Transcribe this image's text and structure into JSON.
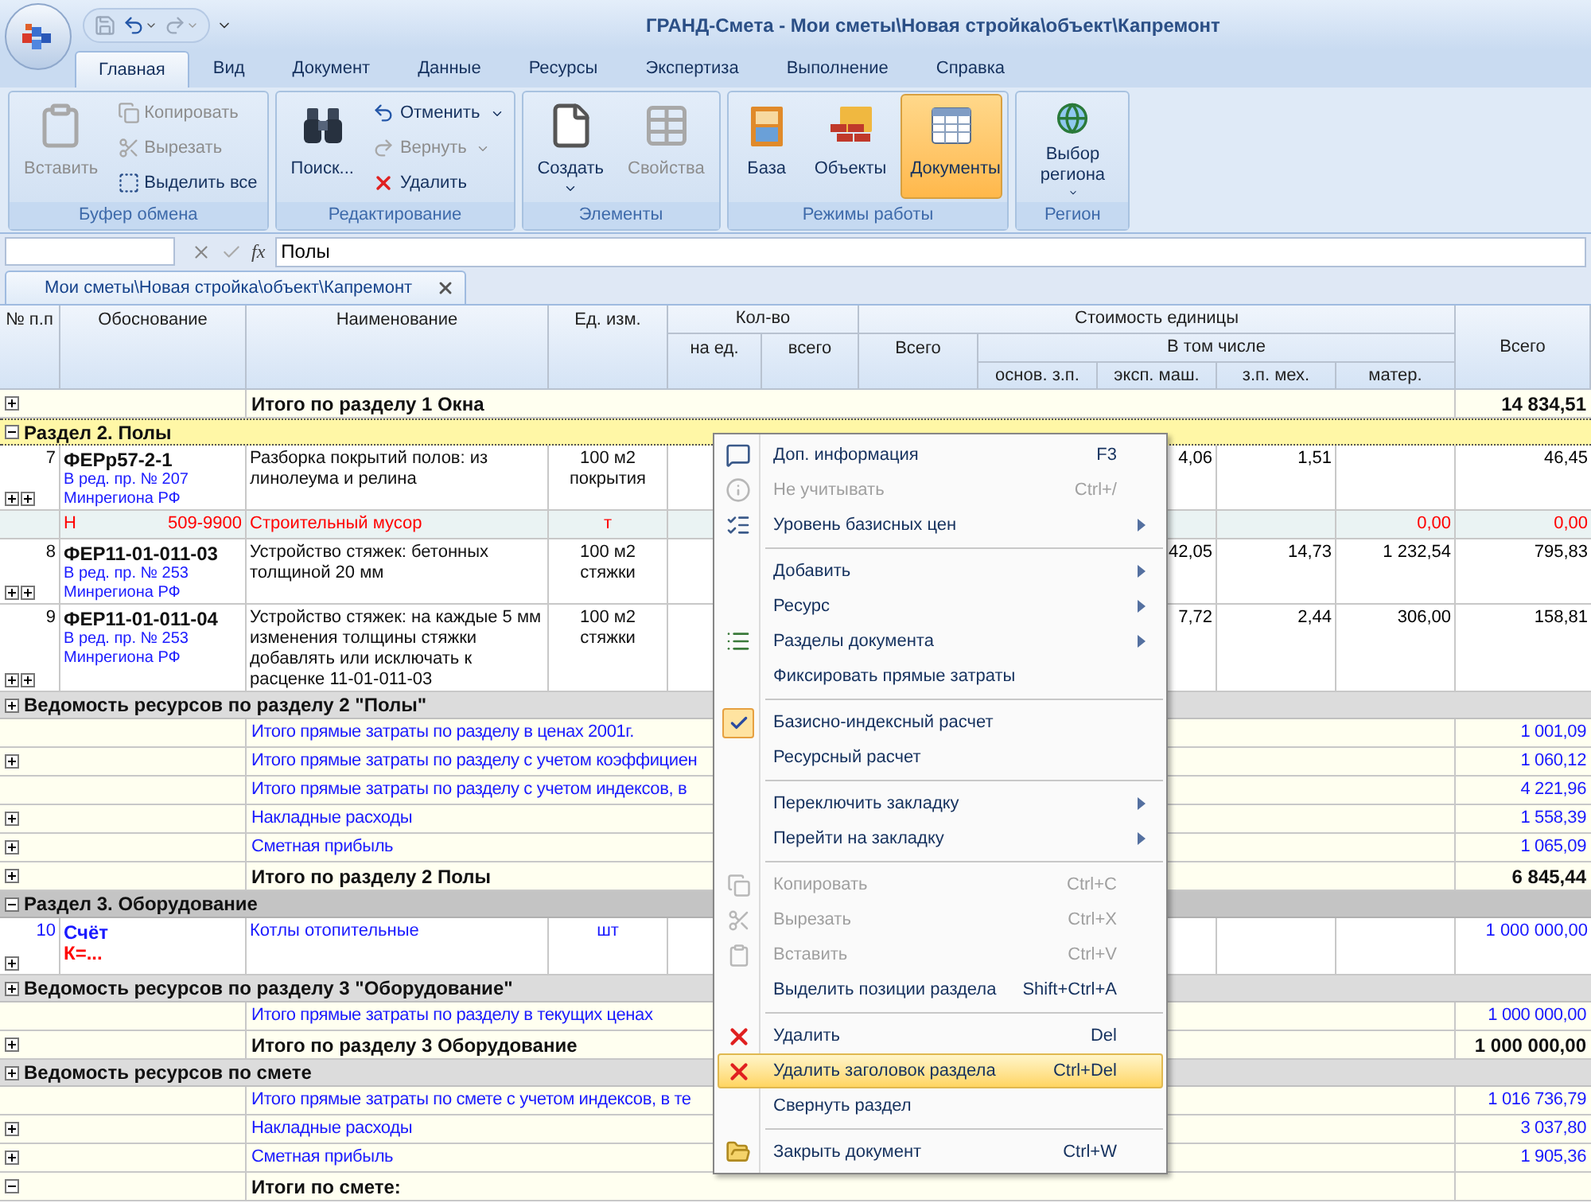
{
  "window": {
    "title": "ГРАНД-Смета - Мои сметы\\Новая стройка\\объект\\Капремонт"
  },
  "ribbon_tabs": [
    {
      "label": "Главная",
      "selected": true
    },
    {
      "label": "Вид",
      "selected": false
    },
    {
      "label": "Документ",
      "selected": false
    },
    {
      "label": "Данные",
      "selected": false
    },
    {
      "label": "Ресурсы",
      "selected": false
    },
    {
      "label": "Экспертиза",
      "selected": false
    },
    {
      "label": "Выполнение",
      "selected": false
    },
    {
      "label": "Справка",
      "selected": false
    }
  ],
  "ribbon_groups": [
    {
      "title": "Буфер обмена",
      "buttons": [
        {
          "label": "Вставить",
          "kind": "large",
          "disabled": true,
          "selected": false,
          "dropdown": false
        },
        {
          "label": "Копировать",
          "kind": "small",
          "disabled": true,
          "selected": false,
          "dropdown": false
        },
        {
          "label": "Вырезать",
          "kind": "small",
          "disabled": true,
          "selected": false,
          "dropdown": false
        },
        {
          "label": "Выделить все",
          "kind": "small",
          "disabled": false,
          "selected": false,
          "dropdown": false
        }
      ]
    },
    {
      "title": "Редактирование",
      "buttons": [
        {
          "label": "Поиск...",
          "kind": "large",
          "disabled": false,
          "selected": false,
          "dropdown": false
        },
        {
          "label": "Отменить",
          "kind": "small",
          "disabled": false,
          "selected": false,
          "dropdown": true
        },
        {
          "label": "Вернуть",
          "kind": "small",
          "disabled": true,
          "selected": false,
          "dropdown": true
        },
        {
          "label": "Удалить",
          "kind": "small",
          "disabled": false,
          "selected": false,
          "dropdown": false
        }
      ]
    },
    {
      "title": "Элементы",
      "buttons": [
        {
          "label": "Создать",
          "kind": "large",
          "disabled": false,
          "selected": false,
          "dropdown": true
        },
        {
          "label": "Свойства",
          "kind": "large",
          "disabled": true,
          "selected": false,
          "dropdown": false
        }
      ]
    },
    {
      "title": "Режимы работы",
      "buttons": [
        {
          "label": "База",
          "kind": "large",
          "disabled": false,
          "selected": false,
          "dropdown": false
        },
        {
          "label": "Объекты",
          "kind": "large",
          "disabled": false,
          "selected": false,
          "dropdown": false
        },
        {
          "label": "Документы",
          "kind": "large",
          "disabled": false,
          "selected": true,
          "dropdown": false
        }
      ]
    },
    {
      "title": "Регион",
      "buttons": [
        {
          "label": "Выбор региона",
          "kind": "large",
          "disabled": false,
          "selected": false,
          "dropdown": true
        }
      ]
    }
  ],
  "formula_bar": {
    "function_label": "fx",
    "value": "Полы"
  },
  "document_tab": {
    "label": "Мои сметы\\Новая стройка\\объект\\Капремонт"
  },
  "table": {
    "headers": {
      "number": "№ п.п",
      "basis": "Обоснование",
      "name": "Наименование",
      "unit": "Ед. изм.",
      "quantity": "Кол-во",
      "per_unit": "на ед.",
      "quantity_total": "всего",
      "unit_cost": "Стоимость единицы",
      "unit_cost_total": "Всего",
      "including": "В том числе",
      "base_wage": "основ. з.п.",
      "machines": "эксп. маш.",
      "mech_wage": "з.п. мех.",
      "materials": "матер.",
      "total": "Всего"
    },
    "rows": [
      {
        "kind": "total",
        "expanded": false,
        "name": "Итого по разделу 1 Окна",
        "total": "14 834,51",
        "selected": false
      },
      {
        "kind": "section",
        "expanded": true,
        "label": "Раздел 2. Полы",
        "selected": true
      },
      {
        "kind": "position",
        "number": "7",
        "code": "ФЕРр57-2-1",
        "note": "В ред. пр. № 207 Минрегиона РФ",
        "name": "Разборка покрытий полов: из линолеума и релина",
        "unit": "100 м2\nпокрытия",
        "expanders": [
          false,
          false
        ],
        "machines": "4,06",
        "mech_wage": "1,51",
        "total": "46,45",
        "selected": false
      },
      {
        "kind": "resource",
        "prefix": "Н",
        "code": "509-9900",
        "name": "Строительный мусор",
        "unit": "т",
        "materials": "0,00",
        "total": "0,00",
        "selected": false
      },
      {
        "kind": "position",
        "number": "8",
        "code": "ФЕР11-01-011-03",
        "note": "В ред. пр. № 253 Минрегиона РФ",
        "name": "Устройство стяжек: бетонных толщиной 20 мм",
        "unit": "100 м2\nстяжки",
        "expanders": [
          false,
          false
        ],
        "machines": "42,05",
        "mech_wage": "14,73",
        "materials": "1 232,54",
        "total": "795,83",
        "selected": false
      },
      {
        "kind": "position",
        "number": "9",
        "code": "ФЕР11-01-011-04",
        "note": "В ред. пр. № 253 Минрегиона РФ",
        "name": "Устройство стяжек: на каждые 5 мм изменения толщины стяжки добавлять или исключать к расценке 11-01-011-03",
        "unit": "100 м2\nстяжки",
        "expanders": [
          false,
          false
        ],
        "machines": "7,72",
        "mech_wage": "2,44",
        "materials": "306,00",
        "total": "158,81",
        "selected": false
      },
      {
        "kind": "statement",
        "expanded": false,
        "label": "Ведомость ресурсов по разделу 2 \"Полы\"",
        "selected": false
      },
      {
        "kind": "subtotal",
        "name": "Итого прямые затраты по разделу в ценах 2001г.",
        "total": "1 001,09",
        "selected": false
      },
      {
        "kind": "subtotal",
        "expanded": false,
        "name": "Итого прямые затраты по разделу с учетом коэффициен",
        "total": "1 060,12",
        "selected": false
      },
      {
        "kind": "subtotal",
        "name": "Итого прямые затраты по разделу с учетом индексов, в",
        "total": "4 221,96",
        "selected": false
      },
      {
        "kind": "subtotal",
        "expanded": false,
        "name": "Накладные расходы",
        "total": "1 558,39",
        "selected": false
      },
      {
        "kind": "subtotal",
        "expanded": false,
        "name": "Сметная прибыль",
        "total": "1 065,09",
        "selected": false
      },
      {
        "kind": "total",
        "expanded": false,
        "name": "Итого по разделу 2 Полы",
        "total": "6 845,44",
        "selected": false
      },
      {
        "kind": "section",
        "expanded": true,
        "label": "Раздел 3. Оборудование",
        "selected": false
      },
      {
        "kind": "invoice",
        "number": "10",
        "code": "Счёт",
        "note": "К=...",
        "name": "Котлы отопительные",
        "unit": "шт",
        "expanders": [
          false
        ],
        "total": "1 000 000,00",
        "selected": false
      },
      {
        "kind": "statement",
        "expanded": false,
        "label": "Ведомость ресурсов по разделу 3 \"Оборудование\"",
        "selected": false
      },
      {
        "kind": "subtotal",
        "name": "Итого прямые затраты по разделу в текущих ценах",
        "total": "1 000 000,00",
        "selected": false
      },
      {
        "kind": "total",
        "expanded": false,
        "name": "Итого по разделу 3 Оборудование",
        "total": "1 000 000,00",
        "selected": false
      },
      {
        "kind": "statement",
        "expanded": false,
        "label": "Ведомость ресурсов по смете",
        "selected": false
      },
      {
        "kind": "subtotal",
        "name": "Итого прямые затраты по смете с учетом индексов, в те",
        "total": "1 016 736,79",
        "selected": false
      },
      {
        "kind": "subtotal",
        "expanded": false,
        "name": "Накладные расходы",
        "total": "3 037,80",
        "selected": false
      },
      {
        "kind": "subtotal",
        "expanded": false,
        "name": "Сметная прибыль",
        "total": "1 905,36",
        "selected": false
      },
      {
        "kind": "total",
        "expanded": true,
        "name": "Итоги по смете:",
        "selected": false
      }
    ]
  },
  "context_menu": {
    "groups": [
      [
        {
          "label": "Доп. информация",
          "shortcut": "F3",
          "disabled": false,
          "submenu": false,
          "checked": false,
          "selected": false
        },
        {
          "label": "Не учитывать",
          "shortcut": "Ctrl+/",
          "disabled": true,
          "submenu": false,
          "checked": false,
          "selected": false
        },
        {
          "label": "Уровень базисных цен",
          "disabled": false,
          "submenu": true,
          "checked": false,
          "selected": false
        }
      ],
      [
        {
          "label": "Добавить",
          "disabled": false,
          "submenu": true,
          "checked": false,
          "selected": false
        },
        {
          "label": "Ресурс",
          "disabled": false,
          "submenu": true,
          "checked": false,
          "selected": false
        },
        {
          "label": "Разделы документа",
          "disabled": false,
          "submenu": true,
          "checked": false,
          "selected": false
        },
        {
          "label": "Фиксировать прямые затраты",
          "disabled": false,
          "submenu": false,
          "checked": false,
          "selected": false
        }
      ],
      [
        {
          "label": "Базисно-индексный расчет",
          "disabled": false,
          "submenu": false,
          "checked": true,
          "selected": false
        },
        {
          "label": "Ресурсный расчет",
          "disabled": false,
          "submenu": false,
          "checked": false,
          "selected": false
        }
      ],
      [
        {
          "label": "Переключить закладку",
          "disabled": false,
          "submenu": true,
          "checked": false,
          "selected": false
        },
        {
          "label": "Перейти на закладку",
          "disabled": false,
          "submenu": true,
          "checked": false,
          "selected": false
        }
      ],
      [
        {
          "label": "Копировать",
          "shortcut": "Ctrl+C",
          "disabled": true,
          "submenu": false,
          "checked": false,
          "selected": false
        },
        {
          "label": "Вырезать",
          "shortcut": "Ctrl+X",
          "disabled": true,
          "submenu": false,
          "checked": false,
          "selected": false
        },
        {
          "label": "Вставить",
          "shortcut": "Ctrl+V",
          "disabled": true,
          "submenu": false,
          "checked": false,
          "selected": false
        },
        {
          "label": "Выделить позиции раздела",
          "shortcut": "Shift+Ctrl+A",
          "disabled": false,
          "submenu": false,
          "checked": false,
          "selected": false
        }
      ],
      [
        {
          "label": "Удалить",
          "shortcut": "Del",
          "disabled": false,
          "submenu": false,
          "checked": false,
          "selected": false
        },
        {
          "label": "Удалить заголовок раздела",
          "shortcut": "Ctrl+Del",
          "disabled": false,
          "submenu": false,
          "checked": false,
          "selected": true
        },
        {
          "label": "Свернуть раздел",
          "disabled": false,
          "submenu": false,
          "checked": false,
          "selected": false
        }
      ],
      [
        {
          "label": "Закрыть документ",
          "shortcut": "Ctrl+W",
          "disabled": false,
          "submenu": false,
          "checked": false,
          "selected": false
        }
      ]
    ]
  }
}
